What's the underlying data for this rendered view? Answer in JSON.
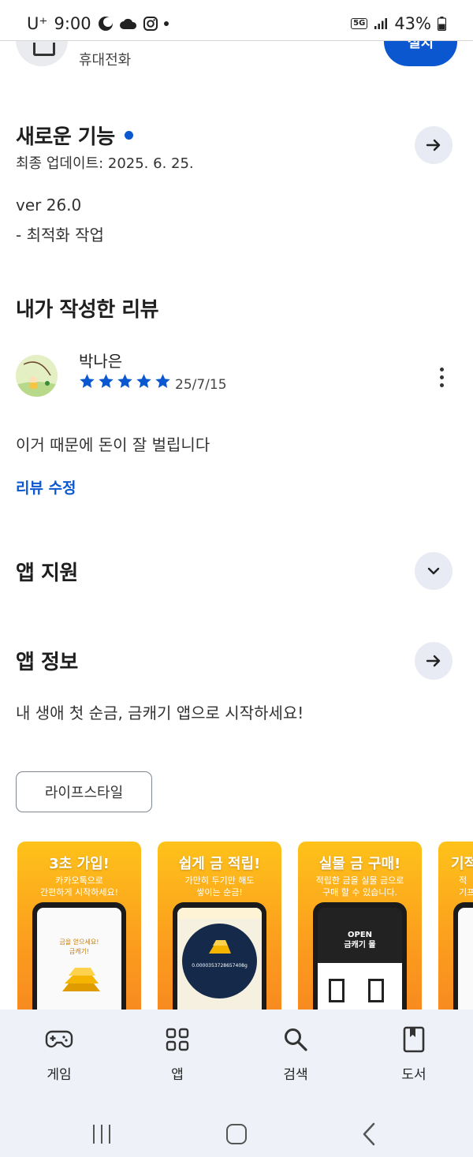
{
  "status_bar": {
    "carrier": "U⁺",
    "time": "9:00",
    "network": "5G",
    "battery": "43%"
  },
  "app_header": {
    "category": "휴대전화",
    "install_label": "설치"
  },
  "whats_new": {
    "title": "새로운 기능",
    "last_updated": "최종 업데이트: 2025. 6. 25.",
    "version": "ver 26.0",
    "notes": "- 최적화 작업"
  },
  "my_review": {
    "title": "내가 작성한 리뷰",
    "reviewer": "박나은",
    "rating": 5,
    "date": "25/7/15",
    "text": "이거 때문에 돈이 잘 벌립니다",
    "edit_label": "리뷰 수정"
  },
  "app_support": {
    "title": "앱 지원"
  },
  "app_info": {
    "title": "앱 정보",
    "description": "내 생애 첫 순금, 금캐기 앱으로 시작하세요!",
    "tag": "라이프스타일"
  },
  "screenshots": [
    {
      "title": "3초 가입!",
      "subtitle": "카카오톡으로\n간편하게 시작하세요!",
      "screen_text": "금을 얻으세요!\n금캐기!"
    },
    {
      "title": "쉽게 금 적립!",
      "subtitle": "가만히 두기만 해도\n쌓이는 순금!",
      "screen_text": "0.0000353728657408g"
    },
    {
      "title": "실물 금 구매!",
      "subtitle": "적립한 금을 실물 금으로\n구매 할 수 있습니다.",
      "screen_text": "OPEN\n금캐기 몰"
    },
    {
      "title": "기적",
      "subtitle": "적\n기프",
      "screen_text": ""
    }
  ],
  "bottom_nav": {
    "items": [
      {
        "label": "게임",
        "icon": "gamepad-icon"
      },
      {
        "label": "앱",
        "icon": "apps-grid-icon"
      },
      {
        "label": "검색",
        "icon": "search-icon"
      },
      {
        "label": "도서",
        "icon": "book-icon"
      }
    ]
  },
  "colors": {
    "accent": "#0b57d0",
    "nav_background": "#eef1f7",
    "round_button": "#e8ebf3",
    "screenshot_gradient_top": "#fec21a",
    "screenshot_gradient_bottom": "#f78720"
  }
}
